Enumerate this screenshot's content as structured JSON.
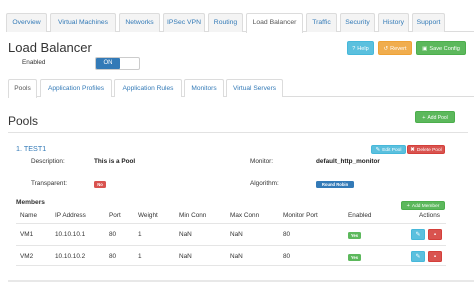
{
  "top_tabs": [
    "Overview",
    "Virtual Machines",
    "Networks",
    "IPSec VPN",
    "Routing",
    "Load Balancer",
    "Traffic",
    "Security",
    "History",
    "Support"
  ],
  "page_title": "Load Balancer",
  "actions": {
    "help": "Help",
    "revert": "Revert",
    "save": "Save Config"
  },
  "enabled": {
    "label": "Enabled",
    "toggle": "ON"
  },
  "sub_tabs": [
    "Pools",
    "Application Profiles",
    "Application Rules",
    "Monitors",
    "Virtual Servers"
  ],
  "add_pool": "Add Pool",
  "section_title": "Pools",
  "pool": {
    "name": "1. TEST1",
    "edit": "Edit Pool",
    "delete": "Delete Pool",
    "description_label": "Description:",
    "description": "This is a Pool",
    "monitor_label": "Monitor:",
    "monitor": "default_http_monitor",
    "transparent_label": "Transparent:",
    "transparent": "No",
    "algorithm_label": "Algorithm:",
    "algorithm": "Round Robin"
  },
  "members": {
    "title": "Members",
    "add": "Add Member",
    "columns": [
      "Name",
      "IP Address",
      "Port",
      "Weight",
      "Min Conn",
      "Max Conn",
      "Monitor Port",
      "Enabled",
      "Actions"
    ],
    "rows": [
      {
        "name": "VM1",
        "ip": "10.10.10.1",
        "port": "80",
        "weight": "1",
        "min_conn": "NaN",
        "max_conn": "NaN",
        "monitor_port": "80",
        "enabled": "Yes"
      },
      {
        "name": "VM2",
        "ip": "10.10.10.2",
        "port": "80",
        "weight": "1",
        "min_conn": "NaN",
        "max_conn": "NaN",
        "monitor_port": "80",
        "enabled": "Yes"
      }
    ]
  },
  "colors": {
    "link": "#337ab7",
    "success": "#5cb85c",
    "info": "#5bc0de",
    "warning": "#f0ad4e",
    "danger": "#d9534f"
  }
}
